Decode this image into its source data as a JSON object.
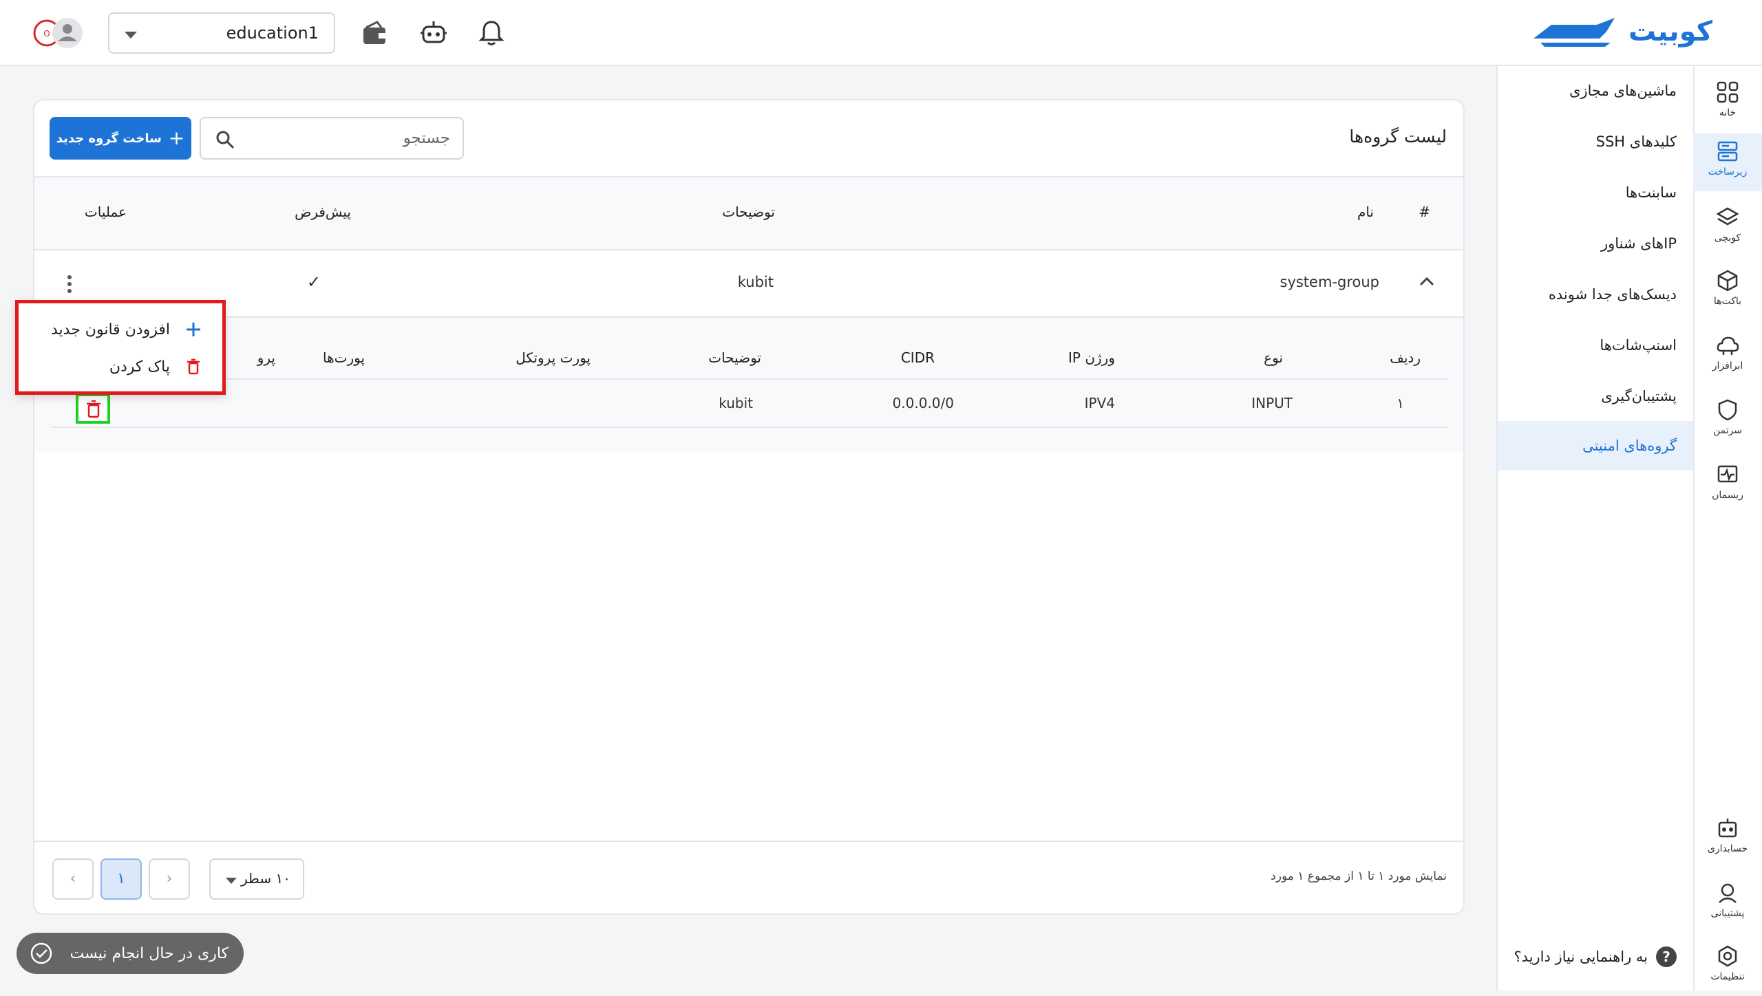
{
  "brand": {
    "name": "کوبیت",
    "color": "#1d74d6"
  },
  "header": {
    "project": "education1",
    "icons": [
      "wallet-icon",
      "robot-icon",
      "bell-icon",
      "avatar-icon"
    ]
  },
  "rail": {
    "items": [
      {
        "label": "خانه",
        "icon": "grid-icon"
      },
      {
        "label": "زیرساخت",
        "icon": "server-icon",
        "active": true
      },
      {
        "label": "کوبچی",
        "icon": "layers-icon"
      },
      {
        "label": "باکت‌ها",
        "icon": "box-icon"
      },
      {
        "label": "ابرافزار",
        "icon": "cloud-icon"
      },
      {
        "label": "سرتمن",
        "icon": "shield-icon"
      },
      {
        "label": "ریسمان",
        "icon": "network-icon"
      },
      {
        "label": "حسابداری",
        "icon": "accounting-icon"
      },
      {
        "label": "پشتیبانی",
        "icon": "support-icon"
      },
      {
        "label": "تنظیمات",
        "icon": "settings-icon"
      }
    ]
  },
  "submenu": {
    "items": [
      {
        "label": "ماشین‌های مجازی"
      },
      {
        "label": "کلیدهای SSH"
      },
      {
        "label": "سابنت‌ها"
      },
      {
        "label": "IPهای شناور"
      },
      {
        "label": "دیسک‌های جدا شونده"
      },
      {
        "label": "اسنپ‌شات‌ها"
      },
      {
        "label": "پشتیبان‌گیری"
      },
      {
        "label": "گروه‌های امنیتی",
        "active": true
      }
    ],
    "help": "به راهنمایی نیاز دارید؟"
  },
  "card": {
    "title": "لیست گروه‌ها",
    "search_placeholder": "جستجو",
    "create_button": "ساخت گروه جدید"
  },
  "table": {
    "headers": {
      "index": "#",
      "name": "نام",
      "description": "توضیحات",
      "default": "پیش‌فرض",
      "actions": "عملیات"
    },
    "rows": [
      {
        "name": "system-group",
        "description": "kubit",
        "default": "✓"
      }
    ]
  },
  "rules": {
    "headers": {
      "row": "ردیف",
      "type": "نوع",
      "ip_version": "ورژن IP",
      "cidr": "CIDR",
      "description": "توضیحات",
      "protocol_port": "پورت پروتکل",
      "ports": "پورت‌ها",
      "protocol": "پرو"
    },
    "rows": [
      {
        "row": "۱",
        "type": "INPUT",
        "ip_version": "IPV4",
        "cidr": "0.0.0.0/0",
        "description": "kubit"
      }
    ]
  },
  "context_menu": {
    "add_rule": "افزودن قانون جدید",
    "delete": "پاک کردن"
  },
  "footer": {
    "summary": "نمایش مورد ۱ تا ۱ از مجموع ۱ مورد",
    "rows_per_page": "۱۰ سطر",
    "current_page": "۱"
  },
  "toast": {
    "text": "کاری در حال انجام نیست"
  }
}
